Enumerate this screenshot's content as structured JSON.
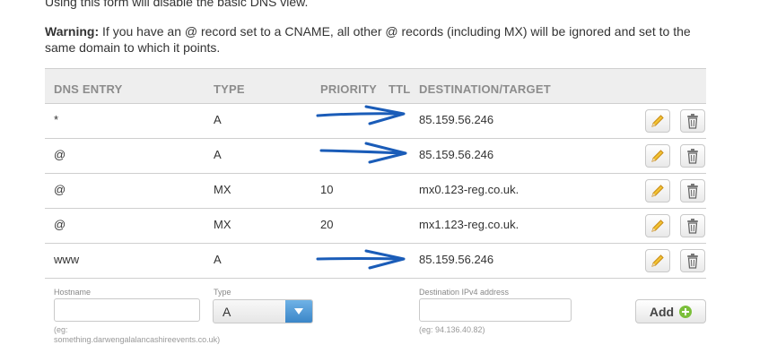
{
  "intro": {
    "note": "Using this form will disable the basic DNS view.",
    "warning_label": "Warning:",
    "warning_text": " If you have an @ record set to a CNAME, all other @ records (including MX) will be ignored and set to the same domain to which it points."
  },
  "table": {
    "headers": {
      "entry": "DNS ENTRY",
      "type": "TYPE",
      "priority": "PRIORITY",
      "ttl": "TTL",
      "destination": "DESTINATION/TARGET"
    },
    "rows": [
      {
        "entry": "*",
        "type": "A",
        "priority": "",
        "ttl": "",
        "destination": "85.159.56.246"
      },
      {
        "entry": "@",
        "type": "A",
        "priority": "",
        "ttl": "",
        "destination": "85.159.56.246"
      },
      {
        "entry": "@",
        "type": "MX",
        "priority": "10",
        "ttl": "",
        "destination": "mx0.123-reg.co.uk."
      },
      {
        "entry": "@",
        "type": "MX",
        "priority": "20",
        "ttl": "",
        "destination": "mx1.123-reg.co.uk."
      },
      {
        "entry": "www",
        "type": "A",
        "priority": "",
        "ttl": "",
        "destination": "85.159.56.246"
      }
    ]
  },
  "form": {
    "hostname_label": "Hostname",
    "hostname_value": "",
    "hostname_hint": "(eg: something.darwengalalancashireevents.co.uk)",
    "type_label": "Type",
    "type_value": "A",
    "destination_label": "Destination IPv4 address",
    "destination_value": "",
    "destination_hint": "(eg: 94.136.40.82)",
    "add_label": "Add"
  },
  "colors": {
    "annotation_arrow": "#1a5cb8",
    "select_arrow_bg": "#4a94d6",
    "add_icon": "#7bbf3a"
  }
}
